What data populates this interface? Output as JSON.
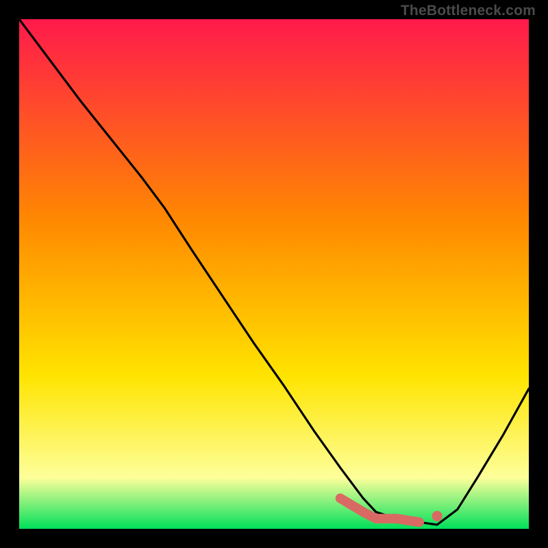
{
  "credit": "TheBottleneck.com",
  "colors": {
    "background": "#000000",
    "gradient_top": "#ff1a4b",
    "gradient_mid1": "#ff8a00",
    "gradient_mid2": "#ffe400",
    "gradient_low": "#fdff9a",
    "gradient_bottom": "#00e05a",
    "curve": "#000000",
    "marker": "#d86a63"
  },
  "chart_data": {
    "type": "line",
    "title": "",
    "xlabel": "",
    "ylabel": "",
    "xlim": [
      0,
      100
    ],
    "ylim": [
      0,
      100
    ],
    "grid": false,
    "curve_note": "Values are bottleneck-percentage-like magnitudes read from the plotted black curve. x is normalized horizontal position (0 left margin to 100 right margin). y is normalized vertical position (0 bottom baseline to 100 top of chart area).",
    "x": [
      0,
      6,
      12,
      18,
      24,
      28.5,
      34,
      40,
      46,
      52,
      58,
      63,
      67.5,
      70,
      74,
      78.5,
      82,
      86,
      90,
      95,
      100
    ],
    "y": [
      100,
      92,
      84,
      76.5,
      69,
      63,
      54.5,
      45.5,
      36.5,
      28,
      19,
      12,
      6,
      3.3,
      2.0,
      1.3,
      0.8,
      3.8,
      10.2,
      18.5,
      27.5
    ],
    "markers_note": "Thick salmon marker segment near the valley bottom (approximate x positions and y heights).",
    "markers": {
      "segment": {
        "x": [
          63,
          67.5,
          70,
          74,
          78.5
        ],
        "y": [
          6,
          3.3,
          2.0,
          2.0,
          1.3
        ]
      },
      "dot": {
        "x": 82,
        "y": 2.5
      }
    }
  }
}
